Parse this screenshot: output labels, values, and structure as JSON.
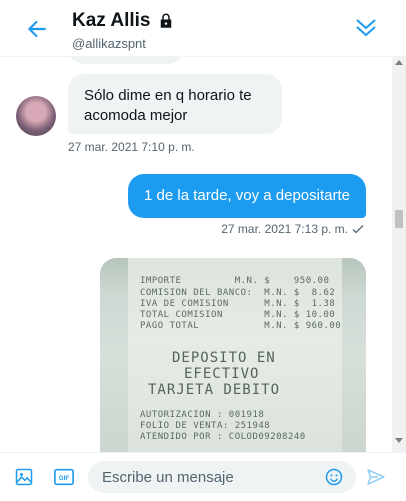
{
  "header": {
    "name": "Kaz Allis",
    "handle": "@allikazspnt"
  },
  "messages": [
    {
      "direction": "in",
      "text": "Sólo dime en q horario te acomoda mejor",
      "timestamp": "27 mar. 2021 7:10 p. m."
    },
    {
      "direction": "out",
      "text": "1 de la tarde, voy a depositarte",
      "timestamp": "27 mar. 2021 7:13 p. m."
    }
  ],
  "receipt": {
    "lines": [
      "IMPORTE         M.N. $    950.00",
      "COMISION DEL BANCO:  M.N. $  8.62",
      "IVA DE COMISION      M.N. $  1.38",
      "TOTAL COMISION       M.N. $ 10.00",
      "PAGO TOTAL           M.N. $ 960.00"
    ],
    "big": [
      "DEPOSITO EN",
      "EFECTIVO",
      "TARJETA DEBITO"
    ],
    "footer": [
      "AUTORIZACION : 001918",
      "FOLIO DE VENTA: 251948",
      "ATENDIDO POR : COLOD09208240"
    ]
  },
  "composer": {
    "placeholder": "Escribe un mensaje",
    "gif_label": "GIF"
  },
  "colors": {
    "accent": "#1d9bf0",
    "incoming_bubble": "#eff3f4",
    "muted_text": "#536471"
  }
}
